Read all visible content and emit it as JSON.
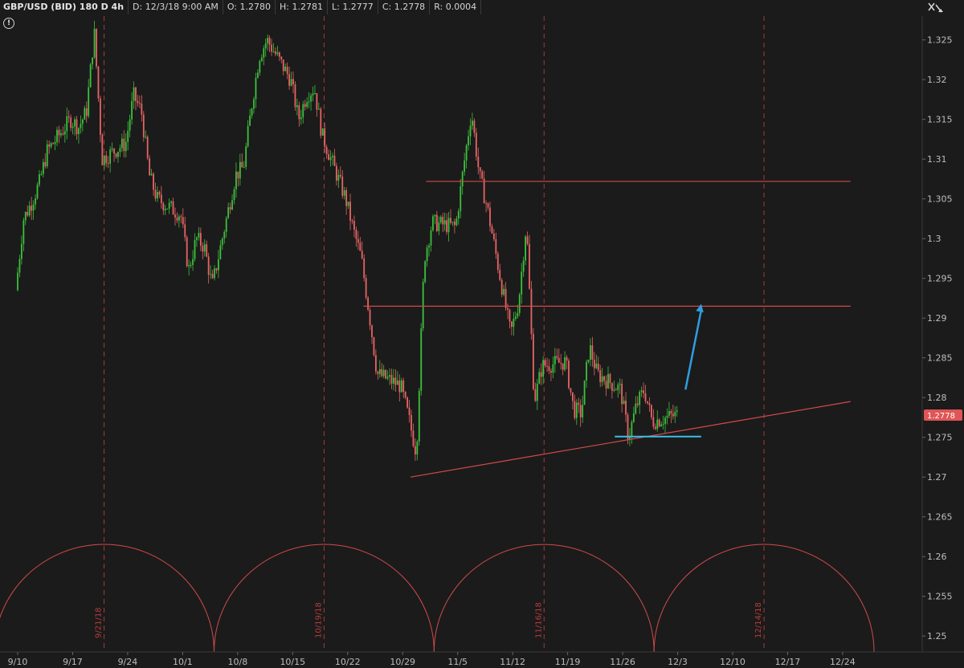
{
  "header": {
    "symbol": "GBP/USD (BID) 180 D 4h",
    "date": "D: 12/3/18 9:00 AM",
    "open": "O: 1.2780",
    "high": "H: 1.2781",
    "low": "L: 1.2777",
    "close": "C: 1.2778",
    "range": "R: 0.0004"
  },
  "alert_glyph": "!",
  "colors": {
    "background": "#1b1b1b",
    "up": "#3cc13c",
    "down": "#e86464",
    "line": "#d24a4a",
    "cyan": "#3bbfe8",
    "arrow": "#2f9ee0",
    "price_tag": "#e05555"
  },
  "icons": {
    "toolbar": "drawing-tools-icon",
    "alert": "alert-icon"
  },
  "chart_data": {
    "type": "candlestick",
    "title": "GBP/USD (BID) 180 D 4h",
    "xlabel": "",
    "ylabel": "",
    "ylim": [
      1.248,
      1.328
    ],
    "y_ticks": [
      "1.325",
      "1.32",
      "1.315",
      "1.31",
      "1.305",
      "1.3",
      "1.295",
      "1.29",
      "1.285",
      "1.28",
      "1.275",
      "1.27",
      "1.265",
      "1.26",
      "1.255",
      "1.25"
    ],
    "x_ticks": [
      "9/10",
      "9/17",
      "9/24",
      "10/1",
      "10/8",
      "10/15",
      "10/22",
      "10/29",
      "11/5",
      "11/12",
      "11/19",
      "11/26",
      "12/3",
      "12/10",
      "12/17",
      "12/24"
    ],
    "x_axis_position": "bottom",
    "y_axis_position": "right",
    "grid": false,
    "current_price": "1.2778",
    "price_path": [
      [
        "9/10",
        1.2935
      ],
      [
        "9/11",
        1.3025
      ],
      [
        "9/12",
        1.3045
      ],
      [
        "9/13",
        1.307
      ],
      [
        "9/14",
        1.311
      ],
      [
        "9/17",
        1.315
      ],
      [
        "9/18",
        1.314
      ],
      [
        "9/19",
        1.316
      ],
      [
        "9/20",
        1.326
      ],
      [
        "9/21",
        1.31
      ],
      [
        "9/24",
        1.312
      ],
      [
        "9/25",
        1.318
      ],
      [
        "9/26",
        1.316
      ],
      [
        "9/27",
        1.308
      ],
      [
        "9/28",
        1.305
      ],
      [
        "10/1",
        1.303
      ],
      [
        "10/2",
        1.296
      ],
      [
        "10/3",
        1.3
      ],
      [
        "10/4",
        1.299
      ],
      [
        "10/5",
        1.294
      ],
      [
        "10/8",
        1.308
      ],
      [
        "10/9",
        1.309
      ],
      [
        "10/10",
        1.3165
      ],
      [
        "10/11",
        1.323
      ],
      [
        "10/12",
        1.325
      ],
      [
        "10/15",
        1.32
      ],
      [
        "10/16",
        1.315
      ],
      [
        "10/17",
        1.318
      ],
      [
        "10/18",
        1.319
      ],
      [
        "10/19",
        1.313
      ],
      [
        "10/22",
        1.305
      ],
      [
        "10/23",
        1.301
      ],
      [
        "10/24",
        1.2975
      ],
      [
        "10/25",
        1.2905
      ],
      [
        "10/26",
        1.283
      ],
      [
        "10/29",
        1.2815
      ],
      [
        "10/30",
        1.2775
      ],
      [
        "10/31",
        1.273
      ],
      [
        "11/1",
        1.2975
      ],
      [
        "11/2",
        1.302
      ],
      [
        "11/5",
        1.3015
      ],
      [
        "11/6",
        1.309
      ],
      [
        "11/7",
        1.316
      ],
      [
        "11/8",
        1.308
      ],
      [
        "11/9",
        1.304
      ],
      [
        "11/12",
        1.288
      ],
      [
        "11/13",
        1.292
      ],
      [
        "11/14",
        1.302
      ],
      [
        "11/15",
        1.2795
      ],
      [
        "11/16",
        1.284
      ],
      [
        "11/19",
        1.2845
      ],
      [
        "11/20",
        1.2785
      ],
      [
        "11/21",
        1.278
      ],
      [
        "11/22",
        1.2865
      ],
      [
        "11/23",
        1.283
      ],
      [
        "11/26",
        1.281
      ],
      [
        "11/27",
        1.275
      ],
      [
        "11/28",
        1.279
      ],
      [
        "11/29",
        1.281
      ],
      [
        "11/30",
        1.277
      ],
      [
        "12/3",
        1.2778
      ]
    ],
    "lines": [
      {
        "name": "resistance",
        "from": [
          "11/1",
          1.3072
        ],
        "to": [
          "12/25",
          1.3072
        ]
      },
      {
        "name": "resistance",
        "from": [
          "10/24",
          1.2915
        ],
        "to": [
          "12/25",
          1.2915
        ]
      },
      {
        "name": "trendline",
        "from": [
          "10/30",
          1.27
        ],
        "to": [
          "12/25",
          1.2795
        ]
      },
      {
        "name": "support",
        "from": [
          "11/25",
          1.2751
        ],
        "to": [
          "12/6",
          1.2751
        ]
      }
    ],
    "arrow": {
      "from": [
        "12/4",
        1.281
      ],
      "to": [
        "12/6",
        1.2918
      ]
    },
    "cycle_labels": [
      {
        "date": "9/21",
        "text": "9/21/18"
      },
      {
        "date": "10/19",
        "text": "10/19/18"
      },
      {
        "date": "11/16",
        "text": "11/16/18"
      },
      {
        "date": "12/14",
        "text": "12/14/18"
      }
    ],
    "cycles": [
      {
        "start": "9/7",
        "end": "10/5"
      },
      {
        "start": "10/5",
        "end": "11/2"
      },
      {
        "start": "11/2",
        "end": "11/30"
      },
      {
        "start": "11/30",
        "end": "12/28"
      }
    ]
  }
}
